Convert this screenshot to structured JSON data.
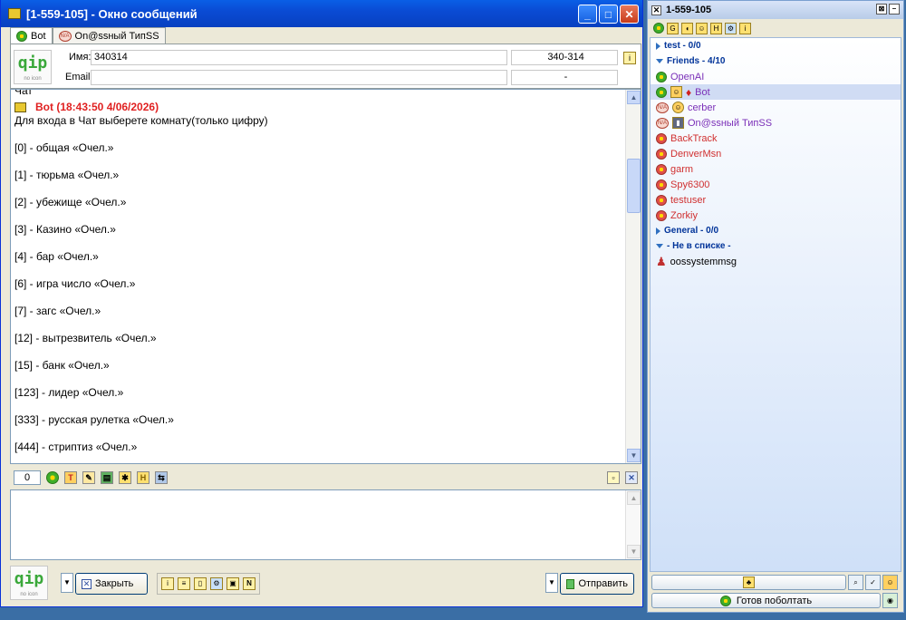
{
  "chat_window": {
    "title": "[1-559-105] - Окно сообщений",
    "tabs": [
      {
        "label": "Bot",
        "active": true
      },
      {
        "label": "On@ssный ТипSS",
        "active": false
      }
    ],
    "logo": {
      "big": "qip",
      "small": "no icon"
    },
    "info": {
      "name_label": "Имя:",
      "name_value": "340314",
      "uin_value": "340-314",
      "email_label": "Email:",
      "email_value": "",
      "extra_value": "-"
    },
    "history": {
      "top_cut": "Чат",
      "sender": "Bot (18:43:50 4/06/2026)",
      "intro": "Для входа в Чат выберете комнату(только цифру)",
      "lines": [
        "[0] - общая «Очел.»",
        "[1] - тюрьма «Очел.»",
        "[2] - убежище «Очел.»",
        "[3] - Казино «Очел.»",
        "[4] - бар «Очел.»",
        "[6] - игра число «Очел.»",
        "[7] - загс «Очел.»",
        "[12] - вытрезвитель «Очел.»",
        "[15] - банк «Очел.»",
        "[123] - лидер «Очел.»",
        "[333] - русская рулетка «Очел.»",
        "[444] - стриптиз «Очел.»"
      ]
    },
    "input_toolbar": {
      "counter": "0",
      "icons": [
        "smile-icon",
        "text-format-icon",
        "paint-icon",
        "save-icon",
        "image-icon",
        "history-icon",
        "transfer-icon"
      ]
    },
    "compose_value": "",
    "buttons": {
      "close_label": "Закрыть",
      "send_label": "Отправить"
    },
    "bottom_icons": [
      "info-icon",
      "notes-icon",
      "file-icon",
      "tools-icon",
      "clip-icon",
      "n-icon"
    ]
  },
  "contact_list": {
    "title": "1-559-105",
    "groups": [
      {
        "name": "test - 0/0",
        "open": false,
        "contacts": []
      },
      {
        "name": "Friends - 4/10",
        "open": true,
        "contacts": [
          {
            "name": "OpenAI",
            "status": "online",
            "color": "#7a2fb8"
          },
          {
            "name": "Bot",
            "status": "online",
            "color": "#7a2fb8",
            "selected": true
          },
          {
            "name": "cerber",
            "status": "na",
            "color": "#7a2fb8"
          },
          {
            "name": "On@ssный ТипSS",
            "status": "na",
            "color": "#7a2fb8"
          },
          {
            "name": "BackTrack",
            "status": "offline",
            "color": "#d03030"
          },
          {
            "name": "DenverMsn",
            "status": "offline",
            "color": "#d03030"
          },
          {
            "name": "garm",
            "status": "offline",
            "color": "#d03030"
          },
          {
            "name": "Spy6300",
            "status": "offline",
            "color": "#d03030"
          },
          {
            "name": "testuser",
            "status": "offline",
            "color": "#d03030"
          },
          {
            "name": "Zorkiy",
            "status": "offline",
            "color": "#d03030"
          }
        ]
      },
      {
        "name": "General - 0/0",
        "open": false,
        "contacts": []
      },
      {
        "name": "- Не в списке -",
        "open": true,
        "contacts": [
          {
            "name": "oossystemmsg",
            "status": "system",
            "color": "#000000"
          }
        ]
      }
    ],
    "status_button": "Готов поболтать"
  }
}
